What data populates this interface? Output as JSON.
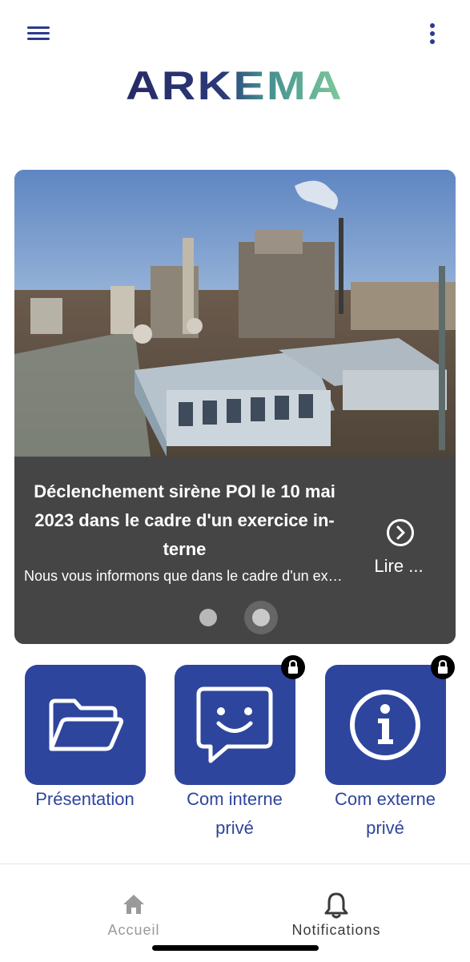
{
  "header": {
    "menu_icon": "hamburger-menu-icon",
    "more_icon": "vertical-dots-icon",
    "logo_text": "ARKEMA",
    "logo_colors": [
      "#2a2d6e",
      "#78c49d"
    ]
  },
  "news_card": {
    "title": "Déclenchement sirène POI le 10 mai 2023 dans le cadre d'un exercice in-terne",
    "title_lines": [
      "Déclenchement sirène POI le 10 mai",
      "2023 dans le cadre d'un exercice in-",
      "terne"
    ],
    "description": "Nous vous informons que dans le cadre d'un exercice interne",
    "read_more_label": "Lire ...",
    "read_more_icon": "chevron-right-circle-icon",
    "carousel": {
      "count": 2,
      "active_index": 1
    }
  },
  "tiles": [
    {
      "label_lines": [
        "Présentation"
      ],
      "icon": "folder-open-icon",
      "locked": false
    },
    {
      "label_lines": [
        "Com interne",
        "privé"
      ],
      "icon": "chat-smile-icon",
      "locked": true
    },
    {
      "label_lines": [
        "Com externe",
        "privé"
      ],
      "icon": "info-circle-icon",
      "locked": true
    }
  ],
  "bottom_nav": {
    "items": [
      {
        "label": "Accueil",
        "icon": "home-icon",
        "active": false
      },
      {
        "label": "Notifications",
        "icon": "bell-icon",
        "active": true
      }
    ]
  },
  "colors": {
    "brand_blue": "#2e459d",
    "card_background": "#454545",
    "nav_inactive": "#9a9a9a",
    "nav_active": "#3a3a3a"
  }
}
